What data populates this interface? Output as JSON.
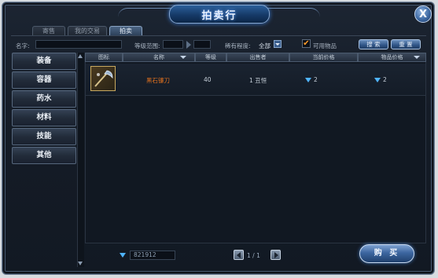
{
  "title": "拍卖行",
  "close_label": "X",
  "tabs": [
    {
      "label": "寄售",
      "active": false
    },
    {
      "label": "我的交易",
      "active": false
    },
    {
      "label": "拍卖",
      "active": true
    }
  ],
  "filters": {
    "name_label": "名字:",
    "name_value": "",
    "level_label": "等级范围:",
    "level_min": "",
    "level_max": "",
    "rarity_label": "稀有程度:",
    "rarity_value": "全部",
    "usable_label": "可用物品",
    "usable_checked": true,
    "search_button": "搜 索",
    "reset_button": "重 置"
  },
  "categories": [
    "装备",
    "容器",
    "药水",
    "材料",
    "技能",
    "其他"
  ],
  "table": {
    "columns": [
      "图标",
      "名称",
      "等级",
      "出售者",
      "当前价格",
      "物品价格"
    ],
    "rows": [
      {
        "name": "黑石镰刀",
        "level": "40",
        "seller": "1 丑恒",
        "current_price": "2",
        "item_price": "2"
      }
    ]
  },
  "footer": {
    "money": "821912",
    "page": "1 / 1",
    "buy_button": "购 买"
  },
  "colors": {
    "item_name": "#e0701e",
    "gem": "#4fb4ff",
    "accent": "#3c66a0"
  }
}
